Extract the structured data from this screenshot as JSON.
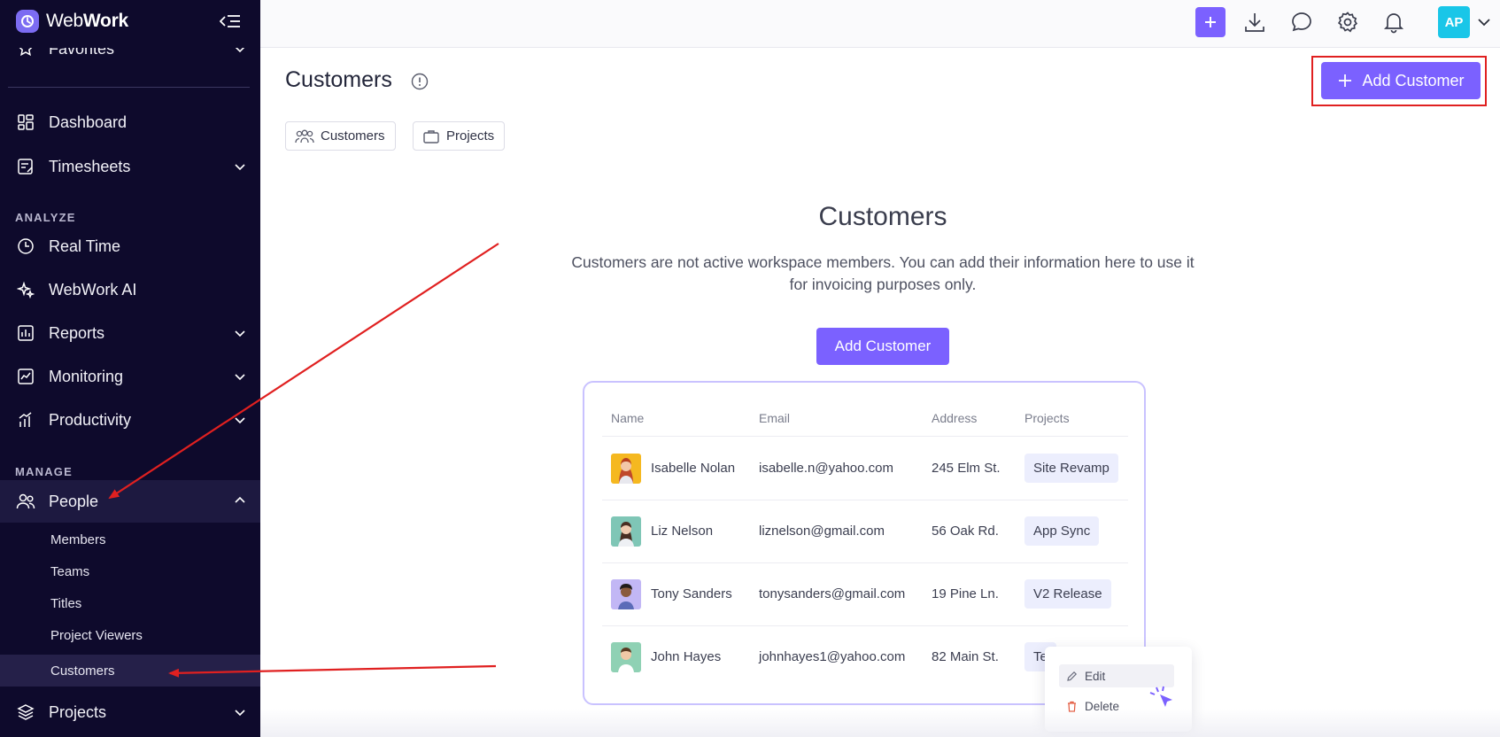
{
  "brand": {
    "name_bold": "Web",
    "name_rest": "Work"
  },
  "sidebar": {
    "favorites_label": "Favorites",
    "top_items": [
      {
        "label": "Dashboard",
        "icon": "dashboard-icon"
      },
      {
        "label": "Timesheets",
        "icon": "timesheet-icon"
      }
    ],
    "analyze_label": "ANALYZE",
    "analyze_items": [
      {
        "label": "Real Time",
        "icon": "clock-icon"
      },
      {
        "label": "WebWork AI",
        "icon": "sparkle-icon"
      },
      {
        "label": "Reports",
        "icon": "reports-icon"
      },
      {
        "label": "Monitoring",
        "icon": "monitoring-icon"
      },
      {
        "label": "Productivity",
        "icon": "productivity-icon"
      }
    ],
    "manage_label": "MANAGE",
    "people_label": "People",
    "people_sub": [
      "Members",
      "Teams",
      "Titles",
      "Project Viewers",
      "Customers"
    ],
    "projects_label": "Projects"
  },
  "topbar": {
    "avatar_initials": "AP"
  },
  "main": {
    "title": "Customers",
    "add_button": "Add Customer",
    "tabs": [
      {
        "label": "Customers",
        "icon": "people-group-icon"
      },
      {
        "label": "Projects",
        "icon": "briefcase-icon"
      }
    ],
    "empty": {
      "title": "Customers",
      "description": "Customers are not active workspace members. You can add their information here to use it for invoicing purposes only.",
      "add_button": "Add Customer"
    },
    "table": {
      "headers": [
        "Name",
        "Email",
        "Address",
        "Projects"
      ],
      "rows": [
        {
          "name": "Isabelle Nolan",
          "email": "isabelle.n@yahoo.com",
          "address": "245 Elm St.",
          "project": "Site Revamp"
        },
        {
          "name": "Liz Nelson",
          "email": "liznelson@gmail.com",
          "address": "56 Oak Rd.",
          "project": "App Sync"
        },
        {
          "name": "Tony Sanders",
          "email": "tonysanders@gmail.com",
          "address": "19 Pine Ln.",
          "project": "V2 Release"
        },
        {
          "name": "John Hayes",
          "email": "johnhayes1@yahoo.com",
          "address": "82 Main St.",
          "project": "Te"
        }
      ]
    },
    "context_menu": {
      "edit": "Edit",
      "delete": "Delete"
    }
  },
  "colors": {
    "sidebar_bg": "#0e0a2c",
    "accent": "#7b61ff",
    "annotation": "#e02020",
    "avatar": "#19c6e8"
  }
}
